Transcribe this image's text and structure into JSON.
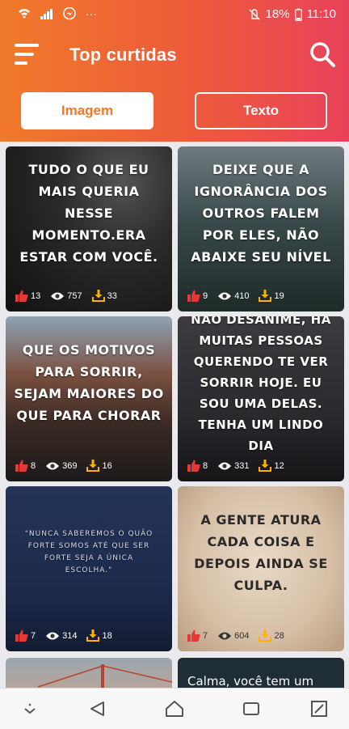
{
  "status_bar": {
    "battery": "18%",
    "time": "11:10",
    "more": "···"
  },
  "toolbar": {
    "title": "Top curtidas"
  },
  "tabs": [
    {
      "label": "Imagem",
      "active": true
    },
    {
      "label": "Texto",
      "active": false
    }
  ],
  "colors": {
    "accent": "#ef7a2c",
    "gradient_start": "#f07a2a",
    "gradient_end": "#e8425a",
    "like": "#e53935",
    "download": "#ffb300"
  },
  "cards": [
    {
      "quote": "Tudo o que eu mais queria nesse momento.era estar com você.",
      "likes": "13",
      "views": "757",
      "downloads": "33"
    },
    {
      "quote": "Deixe que a ignorância dos outros falem por eles, não abaixe seu nível",
      "likes": "9",
      "views": "410",
      "downloads": "19"
    },
    {
      "quote": "Que os motivos para sorrir, sejam maiores do que para chorar",
      "likes": "8",
      "views": "369",
      "downloads": "16"
    },
    {
      "quote": "Não desanime, há muitas pessoas querendo te ver sorrir hoje. eu sou uma delas. tenha um lindo dia",
      "likes": "8",
      "views": "331",
      "downloads": "12"
    },
    {
      "quote": "\"Nunca saberemos o quão forte somos até que ser forte seja a única escolha.\"",
      "likes": "7",
      "views": "314",
      "downloads": "18"
    },
    {
      "quote": "A gente atura cada coisa e depois ainda se culpa.",
      "likes": "7",
      "views": "604",
      "downloads": "28"
    }
  ],
  "partial_cards": [
    {
      "quote": ""
    },
    {
      "quote": "Calma, você tem um"
    }
  ],
  "icons": [
    "wifi-icon",
    "signal-icon",
    "messenger-icon",
    "mute-icon",
    "battery-icon",
    "menu-icon",
    "search-icon",
    "like-icon",
    "view-icon",
    "download-icon",
    "nav-down-icon",
    "back-icon",
    "home-icon",
    "recents-icon",
    "expand-icon"
  ]
}
